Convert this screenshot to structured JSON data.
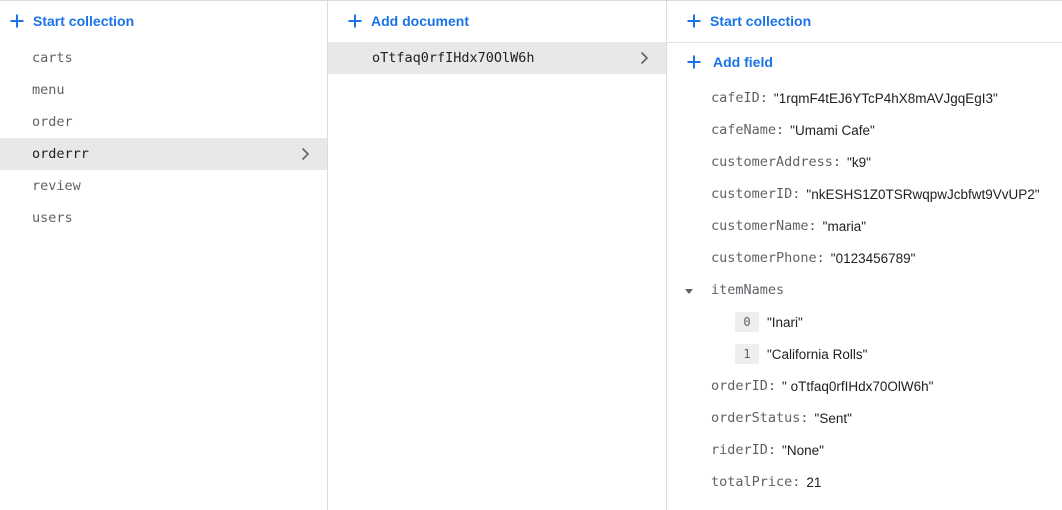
{
  "collections_panel": {
    "action_label": "Start collection",
    "items": [
      {
        "label": "carts"
      },
      {
        "label": "menu"
      },
      {
        "label": "order"
      },
      {
        "label": "orderrr",
        "selected": true
      },
      {
        "label": "review"
      },
      {
        "label": "users"
      }
    ]
  },
  "documents_panel": {
    "action_label": "Add document",
    "items": [
      {
        "label": "oTtfaq0rfIHdx70OlW6h",
        "selected": true
      }
    ]
  },
  "fields_panel": {
    "action_label": "Start collection",
    "add_field_label": "Add field",
    "fields": {
      "cafeID": {
        "key": "cafeID:",
        "value": "\"1rqmF4tEJ6YTcP4hX8mAVJgqEgI3\""
      },
      "cafeName": {
        "key": "cafeName:",
        "value": "\"Umami Cafe\""
      },
      "customerAddress": {
        "key": "customerAddress:",
        "value": "\"k9\""
      },
      "customerID": {
        "key": "customerID:",
        "value": "\"nkESHS1Z0TSRwqpwJcbfwt9VvUP2\""
      },
      "customerName": {
        "key": "customerName:",
        "value": "\"maria\""
      },
      "customerPhone": {
        "key": "customerPhone:",
        "value": "\"0123456789\""
      },
      "itemNames": {
        "key": "itemNames",
        "expanded": true,
        "items": [
          {
            "index": "0",
            "value": "\"Inari\""
          },
          {
            "index": "1",
            "value": "\"California Rolls\""
          }
        ]
      },
      "orderID": {
        "key": "orderID:",
        "value": "\" oTtfaq0rfIHdx70OlW6h\""
      },
      "orderStatus": {
        "key": "orderStatus:",
        "value": "\"Sent\""
      },
      "riderID": {
        "key": "riderID:",
        "value": "\"None\""
      },
      "totalPrice": {
        "key": "totalPrice:",
        "value": "21"
      }
    }
  },
  "colors": {
    "accent": "#1a73e8",
    "selected_row": "#e8e8e8",
    "key_text": "#5f6368",
    "value_text": "#202124"
  },
  "icons": {
    "plus": "plus-icon",
    "chevron": "chevron-right-icon",
    "caret": "caret-down-icon"
  }
}
